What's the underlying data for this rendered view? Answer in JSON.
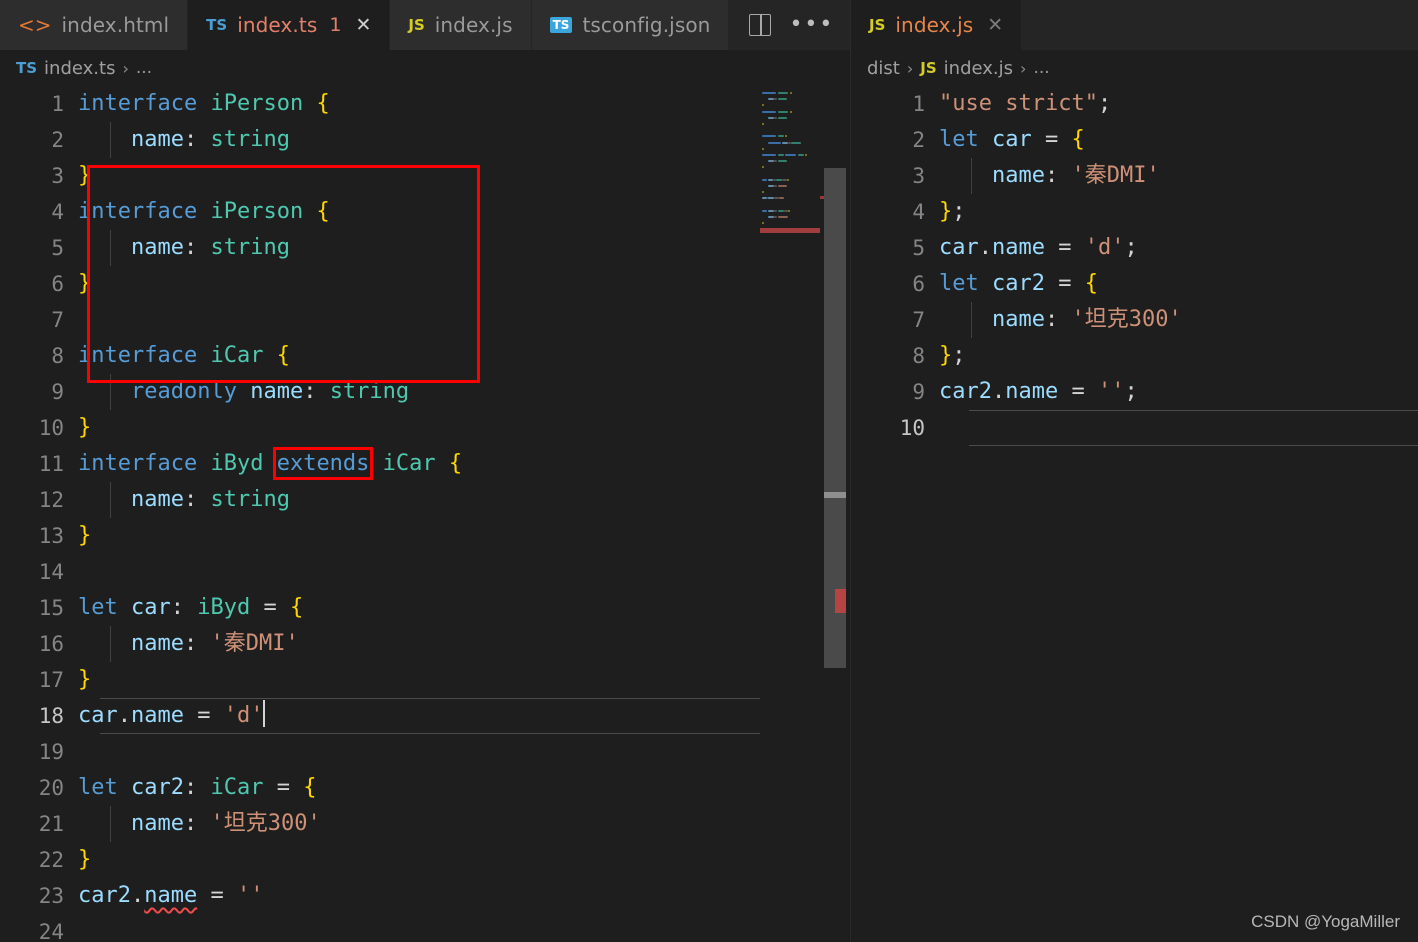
{
  "window": {
    "theme": "Dark+",
    "colors": {
      "editor_bg": "#1e1e1e",
      "tabbar_bg": "#252526",
      "inactive_tab_bg": "#2d2d2d",
      "keyword": "#569cd6",
      "type": "#4ec9b0",
      "property": "#9cdcfe",
      "string": "#ce9178",
      "brace": "#ffd700",
      "error_red": "#ff0000",
      "error_squiggle": "#f14c4c"
    }
  },
  "left_group": {
    "tabs": [
      {
        "label": "index.html",
        "icon": "html-icon",
        "icon_text": "<>",
        "active": false,
        "badge": "",
        "close": ""
      },
      {
        "label": "index.ts",
        "icon": "typescript-icon",
        "icon_text": "TS",
        "active": true,
        "badge": "1",
        "close": "✕"
      },
      {
        "label": "index.js",
        "icon": "javascript-icon",
        "icon_text": "JS",
        "active": false,
        "badge": "",
        "close": ""
      },
      {
        "label": "tsconfig.json",
        "icon": "tsconfig-icon",
        "icon_text": "TS",
        "active": false,
        "badge": "",
        "close": ""
      }
    ],
    "actions": {
      "split_editor": "split-editor-icon",
      "more_actions": "•••"
    },
    "breadcrumb": {
      "icon_text": "TS",
      "file": "index.ts",
      "separator": "›",
      "overflow": "..."
    },
    "active_line": 18,
    "lines": [
      {
        "n": 1,
        "tokens": [
          {
            "t": "interface",
            "c": "kw"
          },
          {
            "t": " ",
            "c": "op"
          },
          {
            "t": "iPerson",
            "c": "typ"
          },
          {
            "t": " ",
            "c": "op"
          },
          {
            "t": "{",
            "c": "br"
          }
        ]
      },
      {
        "n": 2,
        "indent": 1,
        "tokens": [
          {
            "t": "    ",
            "c": "op"
          },
          {
            "t": "name",
            "c": "prop"
          },
          {
            "t": ": ",
            "c": "punc"
          },
          {
            "t": "string",
            "c": "typ"
          }
        ]
      },
      {
        "n": 3,
        "tokens": [
          {
            "t": "}",
            "c": "br"
          }
        ]
      },
      {
        "n": 4,
        "tokens": [
          {
            "t": "interface",
            "c": "kw"
          },
          {
            "t": " ",
            "c": "op"
          },
          {
            "t": "iPerson",
            "c": "typ"
          },
          {
            "t": " ",
            "c": "op"
          },
          {
            "t": "{",
            "c": "br"
          }
        ]
      },
      {
        "n": 5,
        "indent": 1,
        "tokens": [
          {
            "t": "    ",
            "c": "op"
          },
          {
            "t": "name",
            "c": "prop"
          },
          {
            "t": ": ",
            "c": "punc"
          },
          {
            "t": "string",
            "c": "typ"
          }
        ]
      },
      {
        "n": 6,
        "tokens": [
          {
            "t": "}",
            "c": "br"
          }
        ]
      },
      {
        "n": 7,
        "tokens": []
      },
      {
        "n": 8,
        "tokens": [
          {
            "t": "interface",
            "c": "kw"
          },
          {
            "t": " ",
            "c": "op"
          },
          {
            "t": "iCar",
            "c": "typ"
          },
          {
            "t": " ",
            "c": "op"
          },
          {
            "t": "{",
            "c": "br"
          }
        ]
      },
      {
        "n": 9,
        "indent": 1,
        "tokens": [
          {
            "t": "    ",
            "c": "op"
          },
          {
            "t": "readonly",
            "c": "kw"
          },
          {
            "t": " ",
            "c": "op"
          },
          {
            "t": "name",
            "c": "prop"
          },
          {
            "t": ": ",
            "c": "punc"
          },
          {
            "t": "string",
            "c": "typ"
          }
        ]
      },
      {
        "n": 10,
        "tokens": [
          {
            "t": "}",
            "c": "br"
          }
        ]
      },
      {
        "n": 11,
        "tokens": [
          {
            "t": "interface",
            "c": "kw"
          },
          {
            "t": " ",
            "c": "op"
          },
          {
            "t": "iByd",
            "c": "typ"
          },
          {
            "t": " ",
            "c": "op"
          },
          {
            "t": "extends",
            "c": "kw errbox"
          },
          {
            "t": " ",
            "c": "op"
          },
          {
            "t": "iCar",
            "c": "typ"
          },
          {
            "t": " ",
            "c": "op"
          },
          {
            "t": "{",
            "c": "br"
          }
        ]
      },
      {
        "n": 12,
        "indent": 1,
        "tokens": [
          {
            "t": "    ",
            "c": "op"
          },
          {
            "t": "name",
            "c": "prop"
          },
          {
            "t": ": ",
            "c": "punc"
          },
          {
            "t": "string",
            "c": "typ"
          }
        ]
      },
      {
        "n": 13,
        "tokens": [
          {
            "t": "}",
            "c": "br"
          }
        ]
      },
      {
        "n": 14,
        "tokens": []
      },
      {
        "n": 15,
        "tokens": [
          {
            "t": "let",
            "c": "kw"
          },
          {
            "t": " ",
            "c": "op"
          },
          {
            "t": "car",
            "c": "prop"
          },
          {
            "t": ": ",
            "c": "punc"
          },
          {
            "t": "iByd",
            "c": "typ"
          },
          {
            "t": " = ",
            "c": "op"
          },
          {
            "t": "{",
            "c": "br"
          }
        ]
      },
      {
        "n": 16,
        "indent": 1,
        "tokens": [
          {
            "t": "    ",
            "c": "op"
          },
          {
            "t": "name",
            "c": "prop"
          },
          {
            "t": ": ",
            "c": "punc"
          },
          {
            "t": "'秦DMI'",
            "c": "str"
          }
        ]
      },
      {
        "n": 17,
        "tokens": [
          {
            "t": "}",
            "c": "br"
          }
        ]
      },
      {
        "n": 18,
        "active": true,
        "caret": true,
        "tokens": [
          {
            "t": "car",
            "c": "prop"
          },
          {
            "t": ".",
            "c": "punc"
          },
          {
            "t": "name",
            "c": "prop"
          },
          {
            "t": " = ",
            "c": "op"
          },
          {
            "t": "'d'",
            "c": "str"
          }
        ]
      },
      {
        "n": 19,
        "tokens": []
      },
      {
        "n": 20,
        "tokens": [
          {
            "t": "let",
            "c": "kw"
          },
          {
            "t": " ",
            "c": "op"
          },
          {
            "t": "car2",
            "c": "prop"
          },
          {
            "t": ": ",
            "c": "punc"
          },
          {
            "t": "iCar",
            "c": "typ"
          },
          {
            "t": " = ",
            "c": "op"
          },
          {
            "t": "{",
            "c": "br"
          }
        ]
      },
      {
        "n": 21,
        "indent": 1,
        "tokens": [
          {
            "t": "    ",
            "c": "op"
          },
          {
            "t": "name",
            "c": "prop"
          },
          {
            "t": ": ",
            "c": "punc"
          },
          {
            "t": "'坦克300'",
            "c": "str"
          }
        ]
      },
      {
        "n": 22,
        "tokens": [
          {
            "t": "}",
            "c": "br"
          }
        ]
      },
      {
        "n": 23,
        "tokens": [
          {
            "t": "car2",
            "c": "prop"
          },
          {
            "t": ".",
            "c": "punc"
          },
          {
            "t": "name",
            "c": "prop squiggle"
          },
          {
            "t": " = ",
            "c": "op"
          },
          {
            "t": "''",
            "c": "str"
          }
        ]
      },
      {
        "n": 24,
        "tokens": []
      }
    ]
  },
  "right_group": {
    "tabs": [
      {
        "label": "index.js",
        "icon": "javascript-icon",
        "icon_text": "JS",
        "active": true,
        "badge": "",
        "close": "✕"
      }
    ],
    "breadcrumb": {
      "folder": "dist",
      "icon_text": "JS",
      "file": "index.js",
      "separator": "›",
      "overflow": "..."
    },
    "active_line": 10,
    "lines": [
      {
        "n": 1,
        "tokens": [
          {
            "t": "\"use strict\"",
            "c": "str"
          },
          {
            "t": ";",
            "c": "punc"
          }
        ]
      },
      {
        "n": 2,
        "tokens": [
          {
            "t": "let",
            "c": "kw"
          },
          {
            "t": " ",
            "c": "op"
          },
          {
            "t": "car",
            "c": "prop"
          },
          {
            "t": " = ",
            "c": "op"
          },
          {
            "t": "{",
            "c": "br"
          }
        ]
      },
      {
        "n": 3,
        "indent": 1,
        "tokens": [
          {
            "t": "    ",
            "c": "op"
          },
          {
            "t": "name",
            "c": "prop"
          },
          {
            "t": ": ",
            "c": "punc"
          },
          {
            "t": "'秦DMI'",
            "c": "str"
          }
        ]
      },
      {
        "n": 4,
        "tokens": [
          {
            "t": "}",
            "c": "br"
          },
          {
            "t": ";",
            "c": "punc"
          }
        ]
      },
      {
        "n": 5,
        "tokens": [
          {
            "t": "car",
            "c": "prop"
          },
          {
            "t": ".",
            "c": "punc"
          },
          {
            "t": "name",
            "c": "prop"
          },
          {
            "t": " = ",
            "c": "op"
          },
          {
            "t": "'d'",
            "c": "str"
          },
          {
            "t": ";",
            "c": "punc"
          }
        ]
      },
      {
        "n": 6,
        "tokens": [
          {
            "t": "let",
            "c": "kw"
          },
          {
            "t": " ",
            "c": "op"
          },
          {
            "t": "car2",
            "c": "prop"
          },
          {
            "t": " = ",
            "c": "op"
          },
          {
            "t": "{",
            "c": "br"
          }
        ]
      },
      {
        "n": 7,
        "indent": 1,
        "tokens": [
          {
            "t": "    ",
            "c": "op"
          },
          {
            "t": "name",
            "c": "prop"
          },
          {
            "t": ": ",
            "c": "punc"
          },
          {
            "t": "'坦克300'",
            "c": "str"
          }
        ]
      },
      {
        "n": 8,
        "tokens": [
          {
            "t": "}",
            "c": "br"
          },
          {
            "t": ";",
            "c": "punc"
          }
        ]
      },
      {
        "n": 9,
        "tokens": [
          {
            "t": "car2",
            "c": "prop"
          },
          {
            "t": ".",
            "c": "punc"
          },
          {
            "t": "name",
            "c": "prop"
          },
          {
            "t": " = ",
            "c": "op"
          },
          {
            "t": "''",
            "c": "str"
          },
          {
            "t": ";",
            "c": "punc"
          }
        ]
      },
      {
        "n": 10,
        "active": true,
        "tokens": []
      }
    ]
  },
  "minimap": {
    "error_marker": true
  },
  "watermark": "CSDN @YogaMiller"
}
